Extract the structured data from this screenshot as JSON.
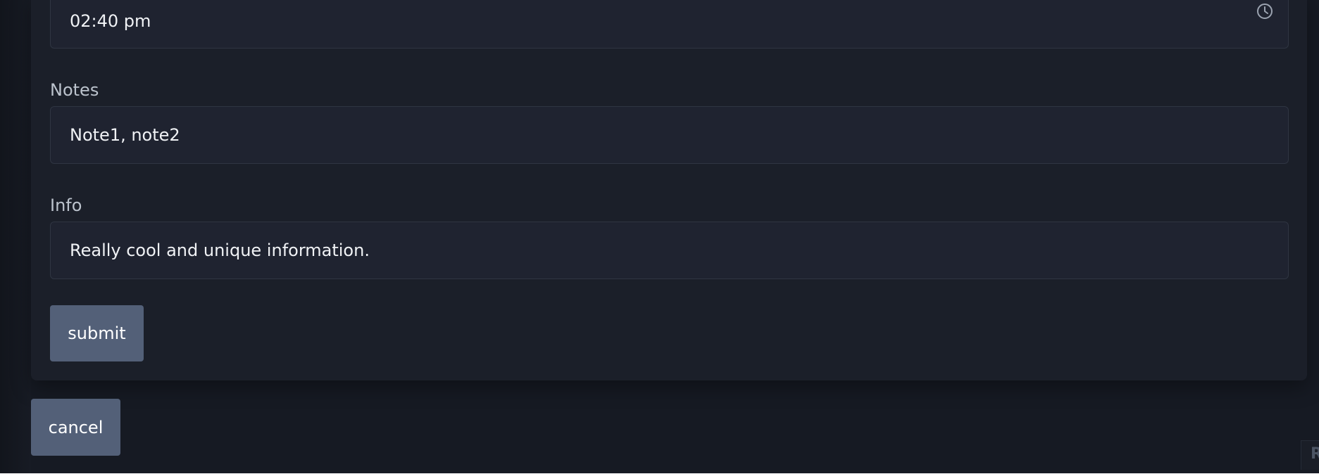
{
  "form": {
    "time_value": "02:40 pm",
    "time_icon": "clock-icon",
    "notes_label": "Notes",
    "notes_value": "Note1, note2",
    "info_label": "Info",
    "info_value": "Really cool and unique information.",
    "submit_label": "submit"
  },
  "footer": {
    "cancel_label": "cancel",
    "corner_fragment": "R"
  },
  "colors": {
    "page_background": "#161a23",
    "card_background": "#1b1f29",
    "input_background": "#1f2330",
    "input_border": "#2f3542",
    "button_background": "#536078"
  }
}
